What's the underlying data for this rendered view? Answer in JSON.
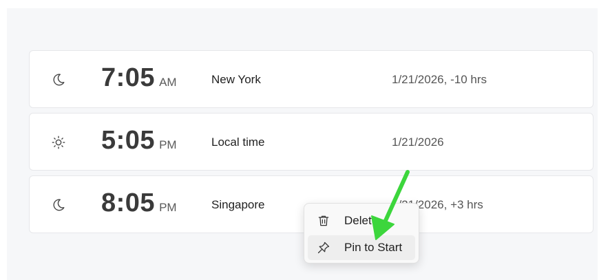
{
  "clocks": [
    {
      "icon": "moon-icon",
      "time": "7:05",
      "period": "AM",
      "city": "New York",
      "date": "1/21/2026, -10 hrs"
    },
    {
      "icon": "sun-icon",
      "time": "5:05",
      "period": "PM",
      "city": "Local time",
      "date": "1/21/2026"
    },
    {
      "icon": "moon-icon",
      "time": "8:05",
      "period": "PM",
      "city": "Singapore",
      "date": "1/21/2026, +3 hrs"
    }
  ],
  "context_menu": {
    "items": [
      {
        "icon": "trash-icon",
        "label": "Delete"
      },
      {
        "icon": "pin-icon",
        "label": "Pin to Start"
      }
    ]
  },
  "colors": {
    "annotation_arrow": "#3cd63c",
    "panel_background": "#f6f7f9",
    "card_border": "#e6e7ea"
  }
}
